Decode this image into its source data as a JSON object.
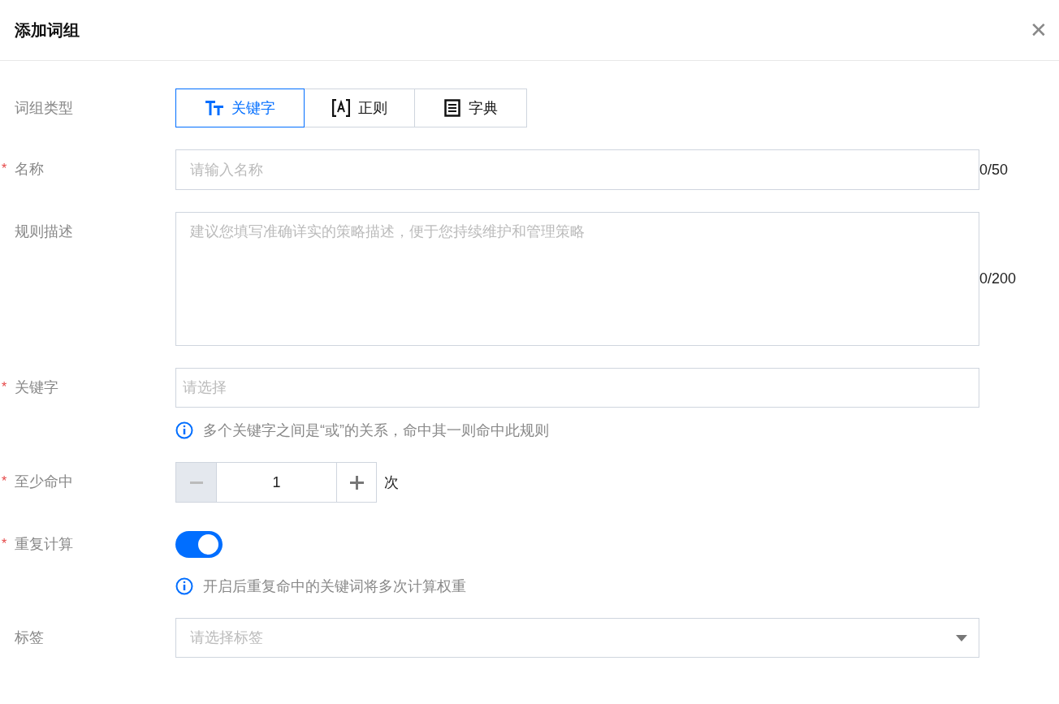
{
  "dialog": {
    "title": "添加词组",
    "close_label": "✕"
  },
  "fields": [
    {
      "kind": "segmented",
      "label": "词组类型",
      "options": [
        {
          "label": "关键字",
          "selected": true
        },
        {
          "label": "正则",
          "selected": false
        },
        {
          "label": "字典",
          "selected": false
        }
      ]
    },
    {
      "kind": "input",
      "label": "名称",
      "required_mark": "*",
      "placeholder": "请输入名称",
      "counter": "0/50"
    },
    {
      "kind": "textarea",
      "label": "规则描述",
      "placeholder": "建议您填写准确详实的策略描述，便于您持续维护和管理策略",
      "counter": "0/200"
    },
    {
      "kind": "select",
      "label": "关键字",
      "required_mark": "*",
      "placeholder": "请选择",
      "hint": "多个关键字之间是“或”的关系，命中其一则命中此规则"
    },
    {
      "kind": "stepper",
      "label": "至少命中",
      "required_mark": "*",
      "value": "1",
      "unit": "次",
      "minus_disabled": true
    },
    {
      "kind": "toggle",
      "label": "重复计算",
      "required_mark": "*",
      "on": true,
      "hint": "开启后重复命中的关键词将多次计算权重"
    },
    {
      "kind": "dropdown",
      "label": "标签",
      "placeholder": "请选择标签"
    }
  ]
}
